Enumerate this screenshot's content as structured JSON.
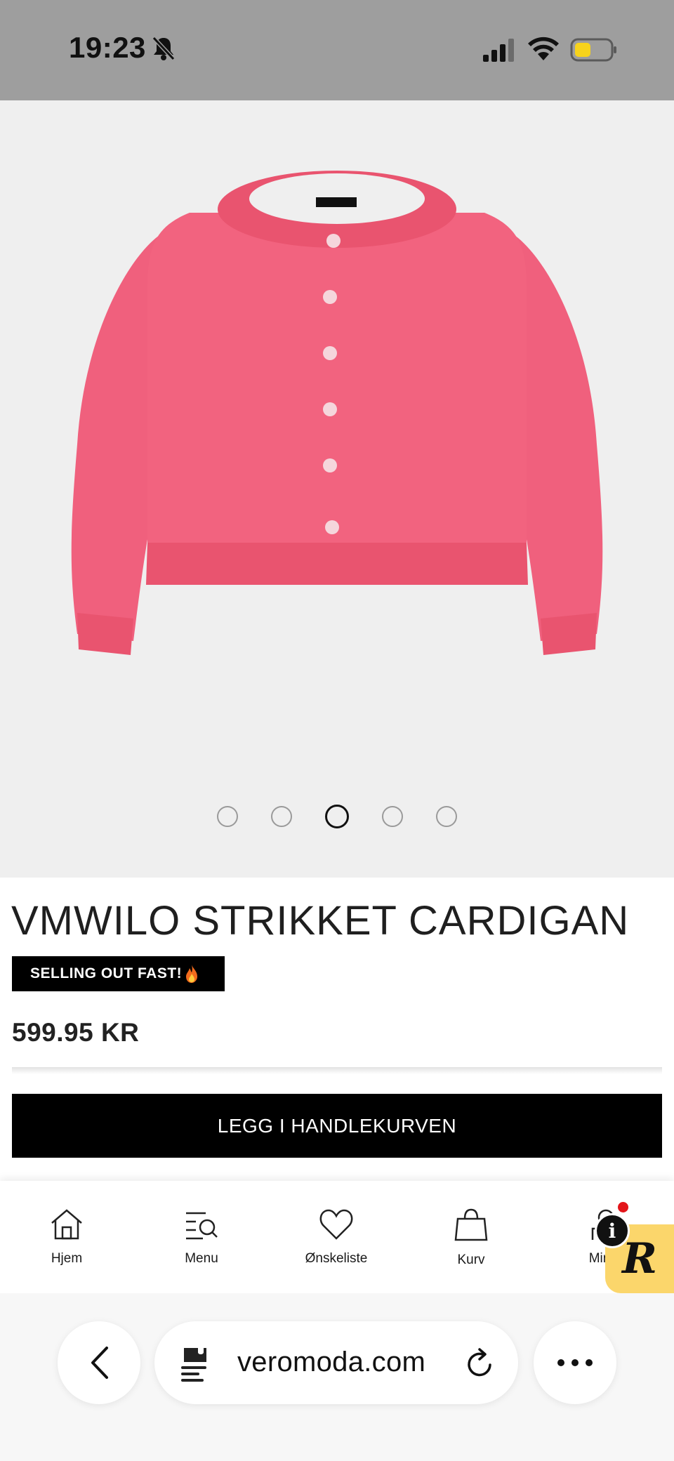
{
  "status_bar": {
    "time": "19:23",
    "icons": [
      "bell-slash-icon",
      "signal-icon",
      "wifi-icon",
      "battery-icon"
    ],
    "battery_color": "#f7d31b"
  },
  "product": {
    "image_alt_color": "#f0607d",
    "carousel": {
      "total": 5,
      "active_index": 3
    },
    "title": "VMWILO STRIKKET CARDIGAN",
    "badge": "SELLING OUT FAST!",
    "badge_icon": "flame-icon",
    "price": "599.95 KR",
    "add_to_cart_label": "LEGG I HANDLEKURVEN"
  },
  "bottom_nav": {
    "items": [
      {
        "label": "Hjem",
        "icon": "home-icon"
      },
      {
        "label": "Menu",
        "icon": "menu-search-icon"
      },
      {
        "label": "Ønskeliste",
        "icon": "heart-icon"
      },
      {
        "label": "Kurv",
        "icon": "bag-icon"
      },
      {
        "label": "Min K",
        "icon": "account-icon"
      }
    ],
    "widget_letter": "R",
    "info_letter": "i"
  },
  "browser": {
    "url": "veromoda.com",
    "icons": [
      "back-icon",
      "page-settings-icon",
      "reload-icon",
      "more-icon"
    ]
  }
}
